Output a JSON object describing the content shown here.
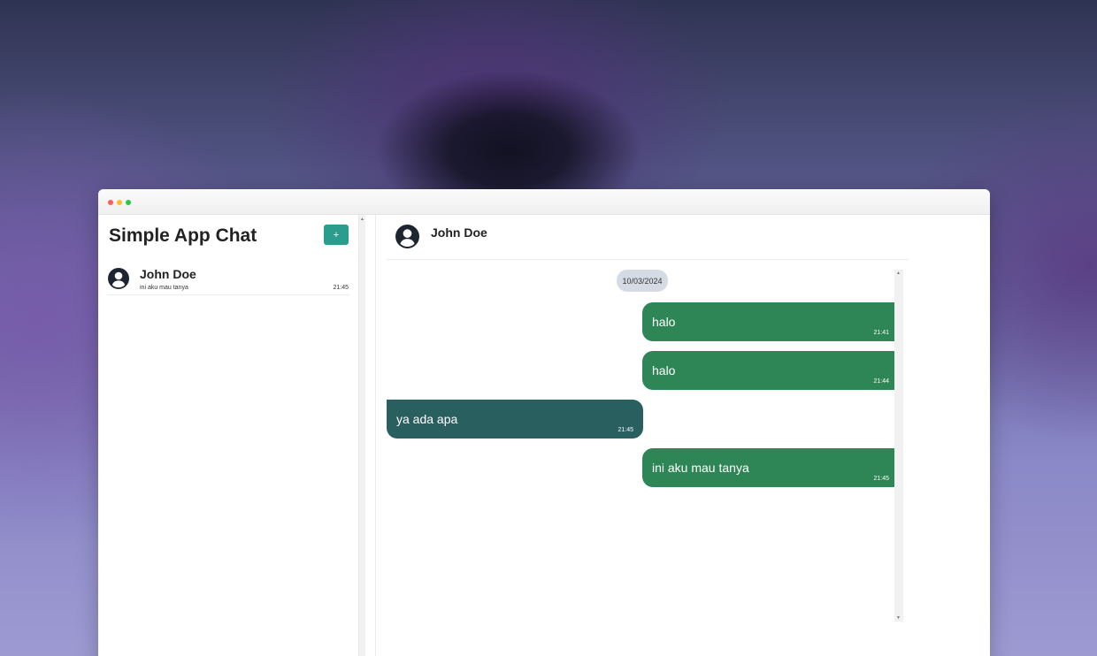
{
  "sidebar": {
    "title": "Simple App Chat",
    "new_button_label": "+",
    "chats": [
      {
        "name": "John Doe",
        "preview": "ini aku mau tanya",
        "time": "21:45",
        "icon": "user-circle-icon"
      }
    ]
  },
  "conversation": {
    "contact_name": "John Doe",
    "date": "10/03/2024",
    "messages": [
      {
        "direction": "outgoing",
        "text": "halo",
        "time": "21:41"
      },
      {
        "direction": "outgoing",
        "text": "halo",
        "time": "21:44"
      },
      {
        "direction": "incoming",
        "text": "ya ada apa",
        "time": "21:45"
      },
      {
        "direction": "outgoing",
        "text": "ini aku mau tanya",
        "time": "21:45"
      }
    ]
  },
  "colors": {
    "accent": "#2a9d8f",
    "outgoing_bubble": "#2e8555",
    "incoming_bubble": "#2a5f60",
    "date_chip": "#d5dbe5"
  }
}
